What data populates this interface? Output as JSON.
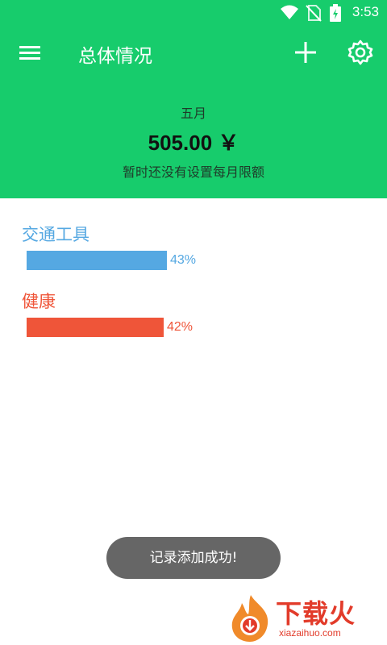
{
  "status": {
    "time": "3:53"
  },
  "toolbar": {
    "title": "总体情况"
  },
  "summary": {
    "month": "五月",
    "amount": "505.00 ￥",
    "budget_note": "暂时还没有设置每月限额"
  },
  "categories": [
    {
      "label": "交通工具",
      "percent_text": "43%",
      "percent": 43,
      "color": "#55a8e2"
    },
    {
      "label": "健康",
      "percent_text": "42%",
      "percent": 42,
      "color": "#ef5539"
    }
  ],
  "toast": {
    "message": "记录添加成功!"
  },
  "watermark": {
    "brand": "下载火",
    "site": "xiazaihuo.com"
  },
  "icons": {
    "wifi": "wifi-icon",
    "no_sim": "no-sim-icon",
    "battery": "battery-charging-icon",
    "menu": "menu-icon",
    "add": "plus-icon",
    "settings": "gear-icon"
  },
  "colors": {
    "header": "#17cc6c"
  }
}
